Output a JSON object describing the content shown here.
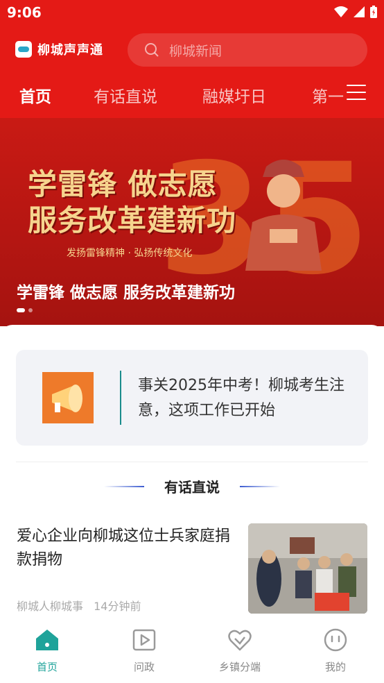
{
  "status_bar": {
    "time": "9:06"
  },
  "app": {
    "name": "柳城声声通"
  },
  "search": {
    "placeholder": "柳城新闻"
  },
  "tabs": [
    {
      "label": "首页",
      "active": true
    },
    {
      "label": "有话直说",
      "active": false
    },
    {
      "label": "融媒圩日",
      "active": false
    },
    {
      "label": "第一",
      "active": false
    }
  ],
  "banner": {
    "headline_line1": "学雷锋 做志愿",
    "headline_line2": "服务改革建新功",
    "subline": "发扬雷锋精神 · 弘扬传统文化",
    "badge_number": "35",
    "caption": "学雷锋 做志愿 服务改革建新功",
    "slide_index": 1,
    "slide_count": 2
  },
  "notice": {
    "text": "事关2025年中考！柳城考生注意，这项工作已开始",
    "icon": "megaphone-icon"
  },
  "section": {
    "title": "有话直说"
  },
  "article": {
    "title": "爱心企业向柳城这位士兵家庭捐款捐物",
    "source": "柳城人柳城事",
    "time": "14分钟前"
  },
  "bottom_nav": [
    {
      "label": "首页",
      "icon": "home-icon",
      "active": true
    },
    {
      "label": "问政",
      "icon": "play-square-icon",
      "active": false
    },
    {
      "label": "乡镇分端",
      "icon": "heart-link-icon",
      "active": false
    },
    {
      "label": "我的",
      "icon": "smiley-icon",
      "active": false
    }
  ],
  "colors": {
    "brand_red": "#e41a16",
    "accent_teal": "#1fa39a",
    "banner_gold": "#f6d48e"
  }
}
